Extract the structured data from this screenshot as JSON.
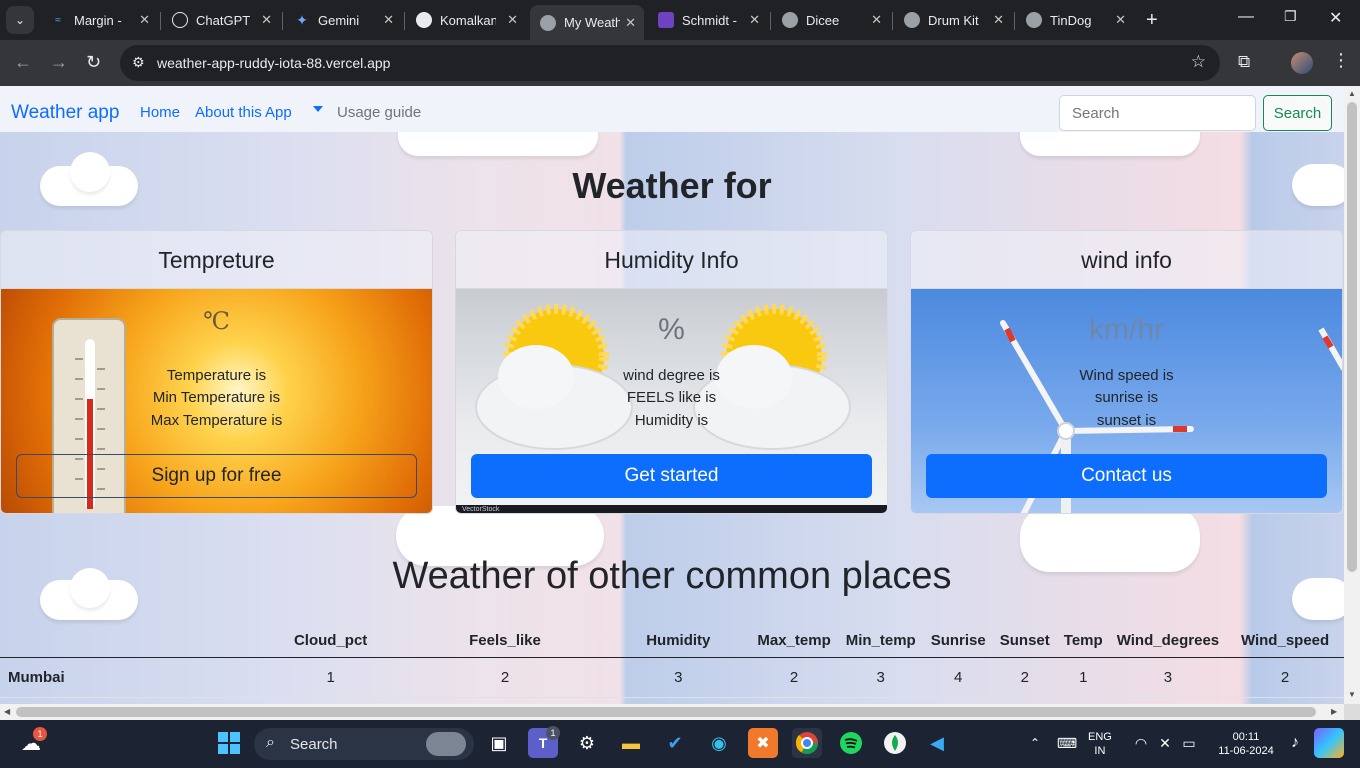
{
  "browser": {
    "tabs": [
      {
        "label": "Margin - ",
        "icon": "wave-icon",
        "active": false
      },
      {
        "label": "ChatGPT",
        "icon": "chatgpt-icon",
        "active": false
      },
      {
        "label": "Gemini",
        "icon": "gemini-icon",
        "active": false
      },
      {
        "label": "Komalkan",
        "icon": "github-icon",
        "active": false
      },
      {
        "label": "My Weath",
        "icon": "globe-icon",
        "active": true
      },
      {
        "label": "Schmidt - ",
        "icon": "colorlib-icon",
        "active": false
      },
      {
        "label": "Dicee",
        "icon": "globe-icon",
        "active": false
      },
      {
        "label": "Drum Kit",
        "icon": "globe-icon",
        "active": false
      },
      {
        "label": "TinDog",
        "icon": "globe-icon",
        "active": false
      }
    ],
    "url": "weather-app-ruddy-iota-88.vercel.app"
  },
  "navbar": {
    "brand": "Weather app",
    "home": "Home",
    "about": "About this App",
    "usage": "Usage guide",
    "search_placeholder": "Search",
    "search_button": "Search"
  },
  "main": {
    "heading": "Weather for",
    "cards": {
      "temperature": {
        "title": "Tempreture",
        "unit": "℃",
        "lines": [
          "Temperature is",
          "Min Temperature is",
          "Max Temperature is"
        ],
        "button": "Sign up for free"
      },
      "humidity": {
        "title": "Humidity Info",
        "unit": "%",
        "lines": [
          "wind degree is",
          "FEELS like is",
          "Humidity is"
        ],
        "button": "Get started",
        "watermark": "VectorStock"
      },
      "wind": {
        "title": "wind info",
        "unit": "km/hr",
        "lines": [
          "Wind speed is",
          "sunrise is",
          "sunset is"
        ],
        "button": "Contact us"
      }
    },
    "other_heading": "Weather of other common places",
    "table": {
      "headers": [
        "",
        "Cloud_pct",
        "Feels_like",
        "Humidity",
        "Max_temp",
        "Min_temp",
        "Sunrise",
        "Sunset",
        "Temp",
        "Wind_degrees",
        "Wind_speed"
      ],
      "rows": [
        [
          "Mumbai",
          "1",
          "2",
          "3",
          "2",
          "3",
          "4",
          "2",
          "1",
          "3",
          "2"
        ]
      ]
    }
  },
  "taskbar": {
    "search": "Search",
    "lang_top": "ENG",
    "lang_bottom": "IN",
    "time": "00:11",
    "date": "11-06-2024",
    "weather_badge": "1",
    "teams_badge": "1"
  }
}
